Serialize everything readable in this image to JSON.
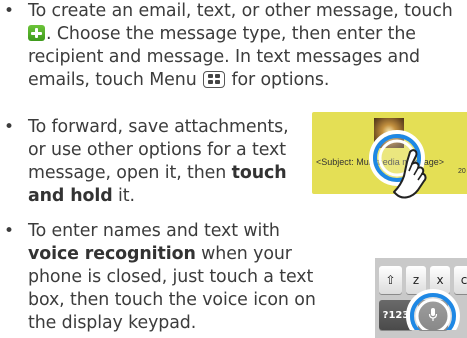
{
  "bullets": [
    {
      "lines": [
        [
          "To create an email, text, or other message, touch"
        ],
        [
          "{plus-icon}",
          ". Choose the message type, then enter the"
        ],
        [
          "recipient and message. In text messages and"
        ],
        [
          "emails, touch Menu ",
          "{menu-key}",
          " for options."
        ]
      ]
    },
    {
      "lines": [
        [
          "To forward, save attachments,"
        ],
        [
          "or use other options for a text"
        ],
        [
          "message, open it, then ",
          "**touch"
        ],
        [
          "**and hold",
          " it."
        ]
      ]
    },
    {
      "lines": [
        [
          "To enter names and text with"
        ],
        [
          "**voice recognition",
          " when your"
        ],
        [
          "phone is closed, just touch a text"
        ],
        [
          "box, then touch the voice icon on"
        ],
        [
          "the display keypad."
        ]
      ]
    }
  ],
  "bullet_char": "•",
  "illustration_message": {
    "subject_text": "<Subject: Multimedia message>",
    "sub_number": "20",
    "bubble_color": "#e4df55"
  },
  "illustration_keypad": {
    "keys": [
      "⇧",
      "z",
      "x",
      "c"
    ],
    "symbol_key": "?123",
    "mic_icon": "microphone-icon"
  },
  "colors": {
    "text": "#3c3c3c",
    "highlight_ring": "#1e88e5",
    "plus_icon": "#4caf27"
  }
}
